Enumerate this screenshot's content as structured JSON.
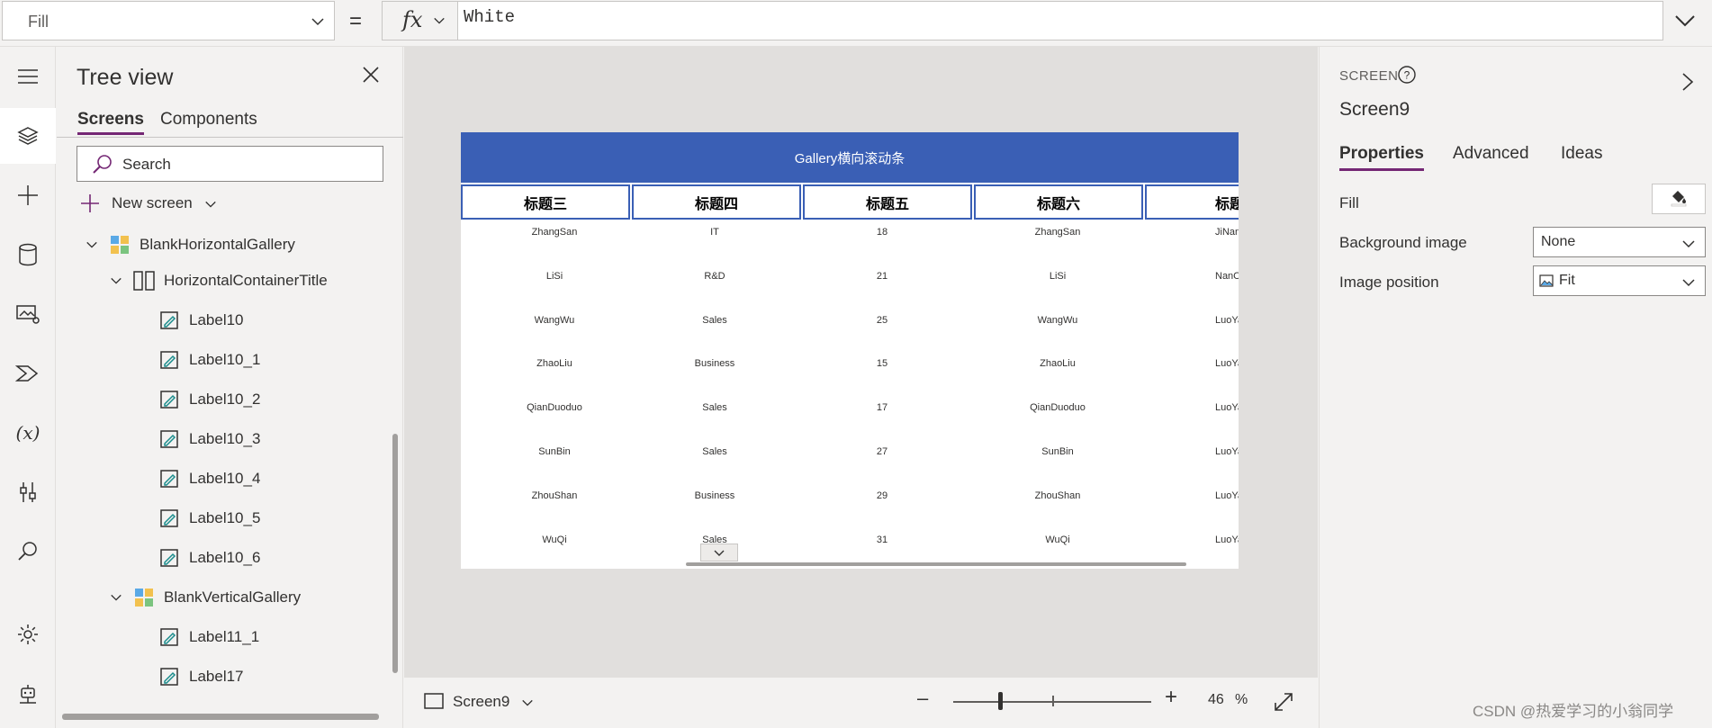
{
  "formula": {
    "property": "Fill",
    "equals": "=",
    "fx": "fx",
    "value": "White"
  },
  "tree": {
    "title": "Tree view",
    "tabs": [
      "Screens",
      "Components"
    ],
    "search_placeholder": "Search",
    "new_screen": "New screen",
    "items": [
      {
        "label": "BlankHorizontalGallery",
        "level": 0,
        "icon": "gallery-icon",
        "expanded": true
      },
      {
        "label": "HorizontalContainerTitle",
        "level": 1,
        "icon": "horizontal-container-icon",
        "expanded": true
      },
      {
        "label": "Label10",
        "level": 2,
        "icon": "label-icon"
      },
      {
        "label": "Label10_1",
        "level": 2,
        "icon": "label-icon"
      },
      {
        "label": "Label10_2",
        "level": 2,
        "icon": "label-icon"
      },
      {
        "label": "Label10_3",
        "level": 2,
        "icon": "label-icon"
      },
      {
        "label": "Label10_4",
        "level": 2,
        "icon": "label-icon"
      },
      {
        "label": "Label10_5",
        "level": 2,
        "icon": "label-icon"
      },
      {
        "label": "Label10_6",
        "level": 2,
        "icon": "label-icon"
      },
      {
        "label": "BlankVerticalGallery",
        "level": 1,
        "icon": "gallery-icon",
        "expanded": true
      },
      {
        "label": "Label11_1",
        "level": 2,
        "icon": "label-icon"
      },
      {
        "label": "Label17",
        "level": 2,
        "icon": "label-icon"
      }
    ]
  },
  "app": {
    "header": "Gallery横向滚动条",
    "columns": [
      "标题三",
      "标题四",
      "标题五",
      "标题六",
      "标题"
    ],
    "rows": [
      [
        "ZhangSan",
        "IT",
        "18",
        "ZhangSan",
        "JiNan"
      ],
      [
        "LiSi",
        "R&D",
        "21",
        "LiSi",
        "NanCha"
      ],
      [
        "WangWu",
        "Sales",
        "25",
        "WangWu",
        "LuoYa"
      ],
      [
        "ZhaoLiu",
        "Business",
        "15",
        "ZhaoLiu",
        "LuoYa"
      ],
      [
        "QianDuoduo",
        "Sales",
        "17",
        "QianDuoduo",
        "LuoYa"
      ],
      [
        "SunBin",
        "Sales",
        "27",
        "SunBin",
        "LuoYa"
      ],
      [
        "ZhouShan",
        "Business",
        "29",
        "ZhouShan",
        "LuoYa"
      ],
      [
        "WuQi",
        "Sales",
        "31",
        "WuQi",
        "LuoYa"
      ]
    ]
  },
  "status": {
    "screen": "Screen9",
    "zoom": "46",
    "zoom_unit": "%"
  },
  "properties": {
    "kind": "SCREEN",
    "name": "Screen9",
    "tabs": [
      "Properties",
      "Advanced",
      "Ideas"
    ],
    "fill_label": "Fill",
    "background_image_label": "Background image",
    "background_image_value": "None",
    "image_position_label": "Image position",
    "image_position_value": "Fit"
  },
  "watermark": "CSDN @热爱学习的小翁同学",
  "colors": {
    "accent": "#742774",
    "app_header": "#3a5fb5"
  }
}
